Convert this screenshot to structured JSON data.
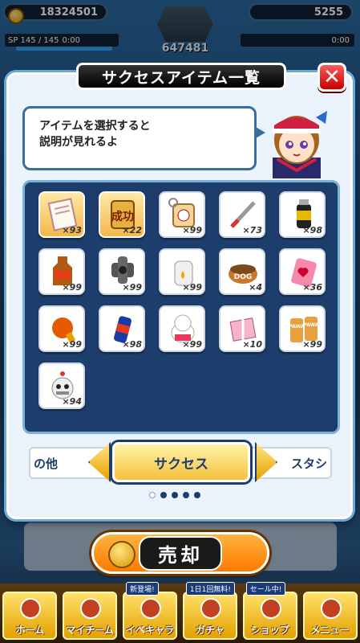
{
  "header": {
    "coins": "18324501",
    "gems": "5255",
    "sp_left": "SP 145 / 145",
    "sp_left_time": "0:00",
    "sp_right_time": "0:00",
    "team_score": "647481"
  },
  "dialog": {
    "title": "サクセスアイテム一覧",
    "close_label": "✕",
    "message_line1": "アイテムを選択すると",
    "message_line2": "説明が見れるよ"
  },
  "items": [
    {
      "icon": "document-icon",
      "count": "×93",
      "selected": true
    },
    {
      "icon": "success-tag-icon",
      "count": "×22",
      "selected": true
    },
    {
      "icon": "baseball-charm-icon",
      "count": "×99"
    },
    {
      "icon": "scalpel-icon",
      "count": "×73"
    },
    {
      "icon": "drink-bottle-icon",
      "count": "×98"
    },
    {
      "icon": "tea-bottle-icon",
      "count": "×99"
    },
    {
      "icon": "pipe-joint-icon",
      "count": "×99"
    },
    {
      "icon": "aroma-pot-icon",
      "count": "×99"
    },
    {
      "icon": "dog-food-icon",
      "count": "×4"
    },
    {
      "icon": "heart-charm-icon",
      "count": "×36"
    },
    {
      "icon": "boxing-glove-icon",
      "count": "×99"
    },
    {
      "icon": "spray-can-icon",
      "count": "×98"
    },
    {
      "icon": "lucky-cat-icon",
      "count": "×99"
    },
    {
      "icon": "gift-box-icon",
      "count": "×10"
    },
    {
      "icon": "pawa-bread-icon",
      "count": "×99"
    },
    {
      "icon": "robot-icon",
      "count": "×94"
    }
  ],
  "category_tabs": {
    "left": "の他",
    "current": "サクセス",
    "right": "スタシ"
  },
  "sell_button": "売却",
  "nav": [
    {
      "label": "ホーム",
      "icon": "home-icon"
    },
    {
      "label": "マイチーム",
      "icon": "team-icon"
    },
    {
      "label": "イベキャラ",
      "icon": "event-chara-icon",
      "badge": "新登場!"
    },
    {
      "label": "ガチャ",
      "icon": "gacha-icon",
      "badge": "1日1回無料!"
    },
    {
      "label": "ショップ",
      "icon": "shop-icon",
      "badge": "セール中!"
    },
    {
      "label": "メニュー",
      "icon": "menu-icon"
    }
  ]
}
